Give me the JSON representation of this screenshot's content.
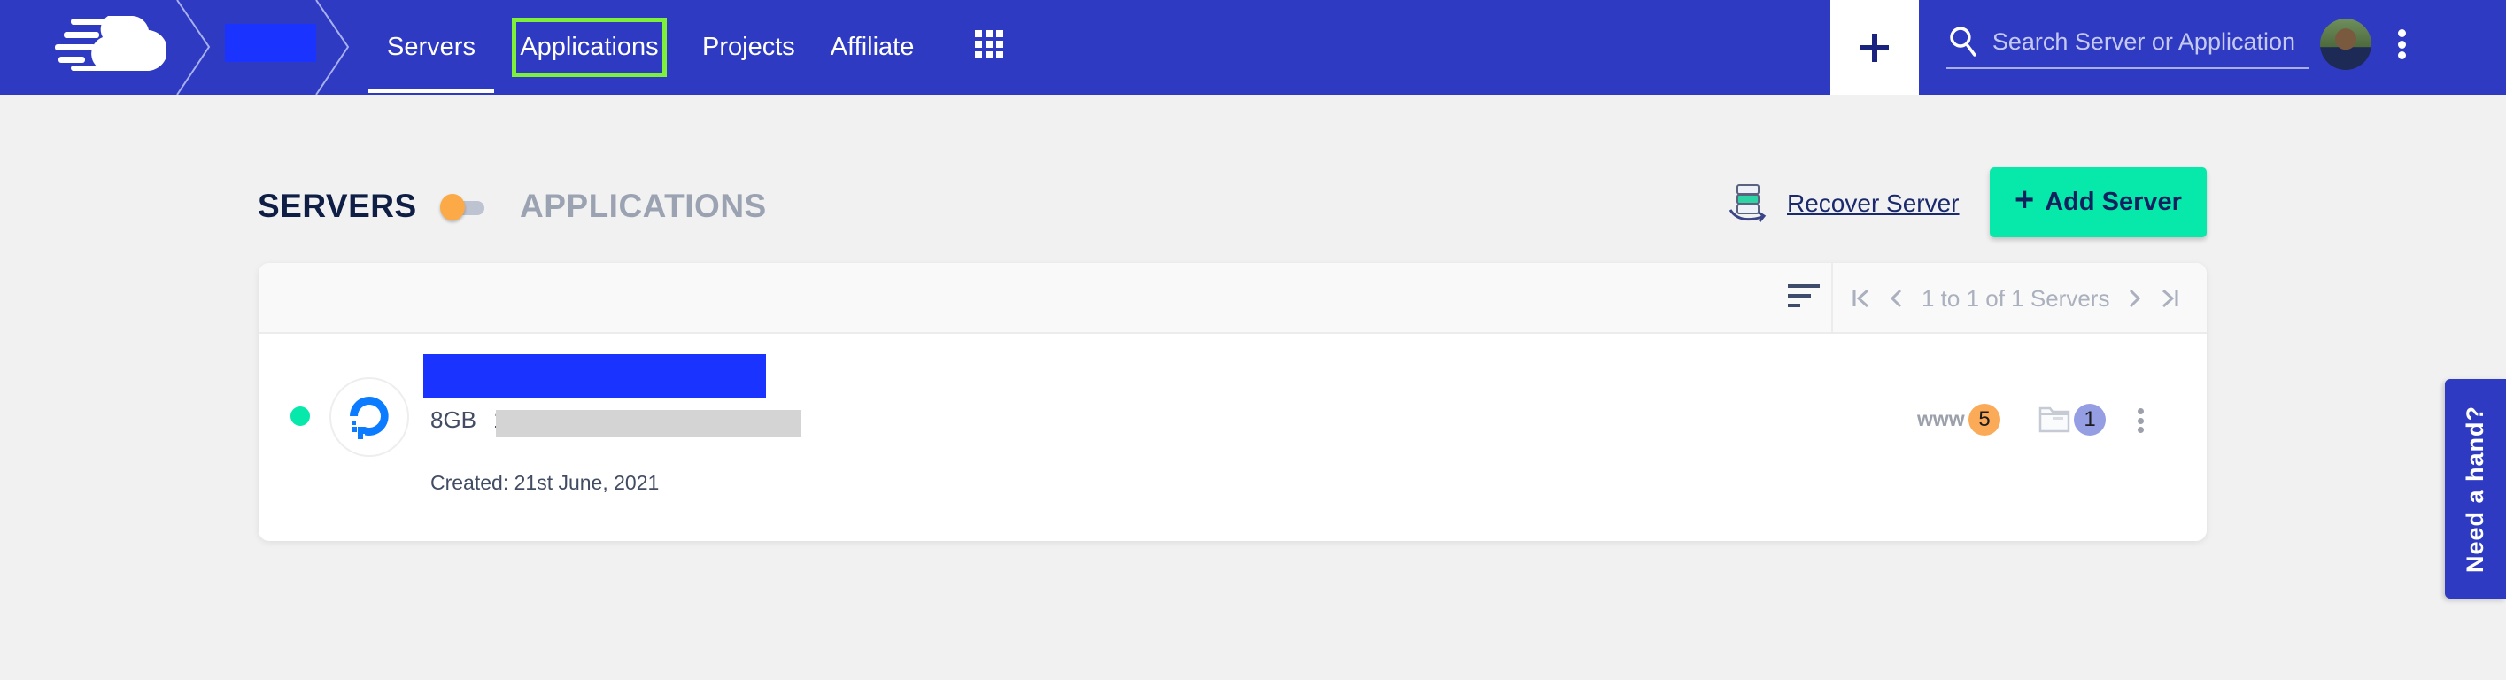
{
  "header": {
    "nav": [
      {
        "label": "Servers",
        "active": true
      },
      {
        "label": "Applications",
        "active": false,
        "highlighted": true
      },
      {
        "label": "Projects",
        "active": false
      },
      {
        "label": "Affiliate",
        "active": false
      }
    ],
    "add_icon": "plus-icon",
    "search": {
      "placeholder": "Search Server or Application",
      "value": ""
    },
    "colors": {
      "header_bg": "#2e3ac1",
      "highlight": "#7ef03a"
    }
  },
  "page": {
    "toggle_left": "SERVERS",
    "toggle_right": "APPLICATIONS",
    "recover_label": "Recover Server",
    "add_server_label": "Add Server"
  },
  "list": {
    "pagination_text": "1 to 1 of 1 Servers",
    "servers": [
      {
        "status": "running",
        "provider": "DigitalOcean",
        "size": "8GB",
        "ip_first_char": "1",
        "created": "Created: 21st June, 2021",
        "www_label": "www",
        "www_count": "5",
        "apps_count": "1"
      }
    ]
  },
  "help": {
    "label": "Need a hand?"
  },
  "colors": {
    "accent_green": "#07e8ab",
    "toggle_orange": "#fbaa47",
    "badge_orange": "#fbaa57",
    "badge_purple": "#959ee3",
    "redacted_blue": "#1a33ff"
  }
}
